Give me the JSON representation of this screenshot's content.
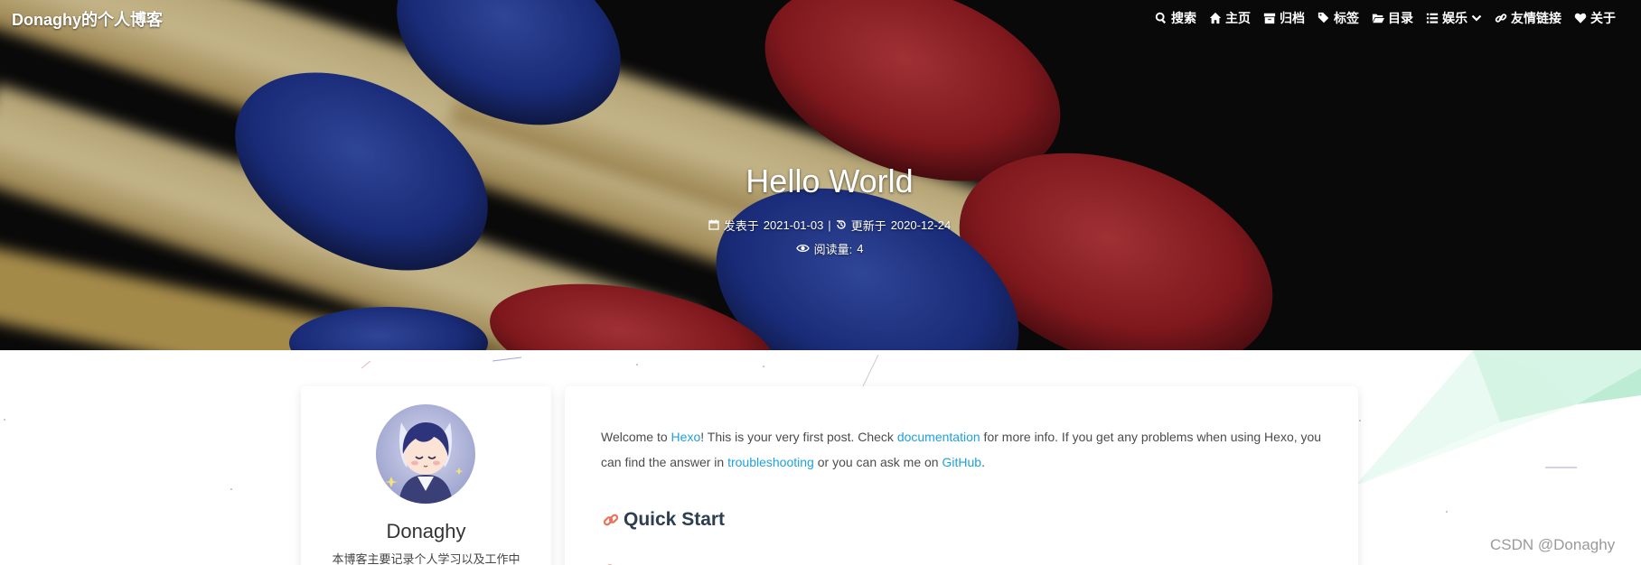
{
  "header": {
    "brand": "Donaghy的个人博客",
    "nav": [
      {
        "icon": "search-icon",
        "label": "搜索"
      },
      {
        "icon": "home-icon",
        "label": "主页"
      },
      {
        "icon": "archive-icon",
        "label": "归档"
      },
      {
        "icon": "tags-icon",
        "label": "标签"
      },
      {
        "icon": "folder-icon",
        "label": "目录"
      },
      {
        "icon": "list-icon",
        "label": "娱乐"
      },
      {
        "icon": "link-icon",
        "label": "友情链接"
      },
      {
        "icon": "heart-icon",
        "label": "关于"
      }
    ]
  },
  "post": {
    "title": "Hello World",
    "posted_label": "发表于",
    "posted_date": "2021-01-03",
    "separator": "|",
    "updated_label": "更新于",
    "updated_date": "2020-12-24",
    "views_label": "阅读量:",
    "views_count": "4"
  },
  "sidebar": {
    "author_name": "Donaghy",
    "bio": "本博客主要记录个人学习以及工作中"
  },
  "content": {
    "p1": "Welcome to ",
    "link_hexo": "Hexo",
    "p2": "! This is your very first post. Check ",
    "link_docs": "documentation",
    "p3": " for more info. If you get any problems when using Hexo, you can find the answer in ",
    "link_trouble": "troubleshooting",
    "p4": " or you can ask me on ",
    "link_github": "GitHub",
    "p5": ".",
    "heading": "Quick Start"
  },
  "watermark": "CSDN @Donaghy",
  "colors": {
    "link": "#1ea1e0",
    "heading": "#2c3e50",
    "anchor_icon": "#e8735a"
  }
}
